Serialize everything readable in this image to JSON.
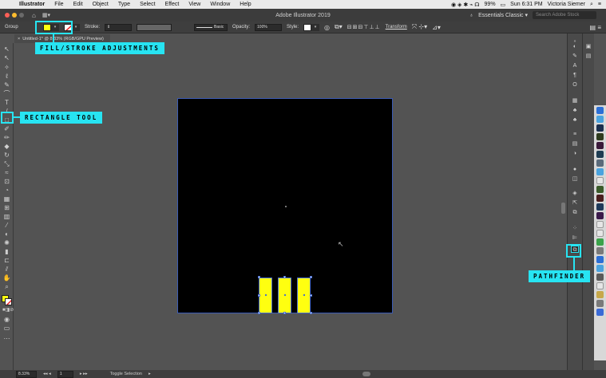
{
  "menubar": {
    "app_name": "Illustrator",
    "items": [
      "File",
      "Edit",
      "Object",
      "Type",
      "Select",
      "Effect",
      "View",
      "Window",
      "Help"
    ],
    "battery": "99%",
    "clock": "Sun 6:31 PM",
    "user": "Victoria Siemer"
  },
  "appbar": {
    "title": "Adobe Illustrator 2019",
    "workspace": "Essentials Classic",
    "search_placeholder": "Search Adobe Stock"
  },
  "controlbar": {
    "selection_label": "Group",
    "stroke_label": "Stroke:",
    "stroke_style": "Basic",
    "opacity_label": "Opacity:",
    "opacity_value": "100%",
    "style_label": "Style:",
    "transform_label": "Transform",
    "fill_color": "#ffff10"
  },
  "document": {
    "tab_title": "Untitled-1* @ 8.33% (RGB/GPU Preview)"
  },
  "statusbar": {
    "zoom": "8.33%",
    "artboard": "1",
    "mode": "Toggle Selection"
  },
  "annotations": {
    "fill_stroke": "FILL/STROKE ADJUSTMENTS",
    "rectangle_tool": "RECTANGLE TOOL",
    "pathfinder": "PATHFINDER",
    "color": "#27e4f2"
  },
  "artboard": {
    "bars": 3,
    "bar_color": "#ffff10"
  }
}
